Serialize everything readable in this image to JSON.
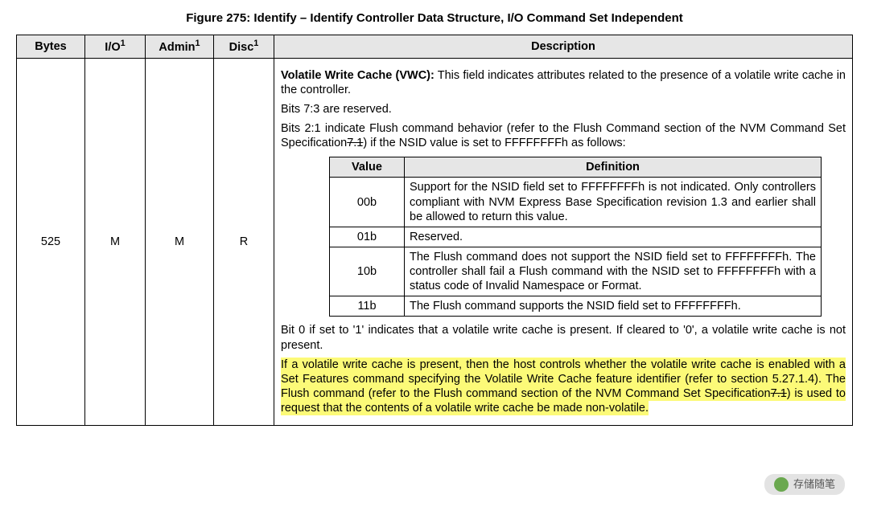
{
  "title": "Figure 275: Identify – Identify Controller Data Structure, I/O Command Set Independent",
  "headers": {
    "bytes": "Bytes",
    "io": "I/O",
    "admin": "Admin",
    "disc": "Disc",
    "desc": "Description",
    "sup": "1"
  },
  "row": {
    "bytes": "525",
    "io": "M",
    "admin": "M",
    "disc": "R"
  },
  "desc": {
    "p1a": "Volatile Write Cache (VWC):",
    "p1b": " This field indicates attributes related to the presence of a volatile write cache in the controller.",
    "p2": "Bits 7:3 are reserved.",
    "p3a": "Bits 2:1 indicate Flush command behavior (refer to the Flush Command section of the NVM Command Set Specification",
    "p3s": "7.1",
    "p3b": ") if the NSID value is set to FFFFFFFFh as follows:",
    "p4": "Bit 0 if set to '1' indicates that a volatile write cache is present. If cleared to '0', a volatile write cache is not present.",
    "p5a": "If a volatile write cache is present, then the host controls whether the volatile write cache is enabled with a Set Features command specifying the Volatile Write Cache feature identifier (refer to section 5.27.1.4). The Flush command (refer to the Flush command section of the NVM Command Set Specification",
    "p5s": "7.1",
    "p5b": ") is used to request that the contents of a volatile write cache be made non-volatile."
  },
  "inner": {
    "hvalue": "Value",
    "hdef": "Definition",
    "rows": [
      {
        "v": "00b",
        "d": "Support for the NSID field set to FFFFFFFFh is not indicated. Only controllers compliant with NVM Express Base Specification revision 1.3 and earlier shall be allowed to return this value."
      },
      {
        "v": "01b",
        "d": "Reserved."
      },
      {
        "v": "10b",
        "d": "The Flush command does not support the NSID field set to FFFFFFFFh. The controller shall fail a Flush command with the NSID set to FFFFFFFFh with a status code of Invalid Namespace or Format."
      },
      {
        "v": "11b",
        "d": "The Flush command supports the NSID field set to FFFFFFFFh."
      }
    ]
  },
  "watermark": "存储随笔"
}
